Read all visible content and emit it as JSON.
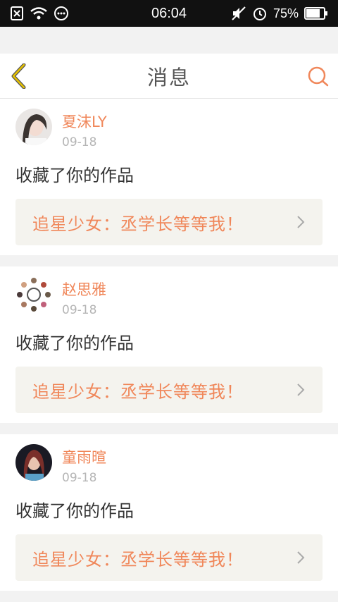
{
  "status_bar": {
    "time": "06:04",
    "battery": "75%",
    "icons": [
      "sim-blocked-icon",
      "wifi-icon",
      "message-icon",
      "mute-icon",
      "alarm-icon",
      "battery-icon"
    ]
  },
  "header": {
    "title": "消息",
    "accent_color": "#f0875a",
    "back_color": "#e6c200"
  },
  "messages": [
    {
      "user": "夏沫LY",
      "date": "09-18",
      "action": "收藏了你的作品",
      "work": "追星少女：丞学长等等我！"
    },
    {
      "user": "赵思雅",
      "date": "09-18",
      "action": "收藏了你的作品",
      "work": "追星少女：丞学长等等我！"
    },
    {
      "user": "童雨暄",
      "date": "09-18",
      "action": "收藏了你的作品",
      "work": "追星少女：丞学长等等我！"
    }
  ]
}
